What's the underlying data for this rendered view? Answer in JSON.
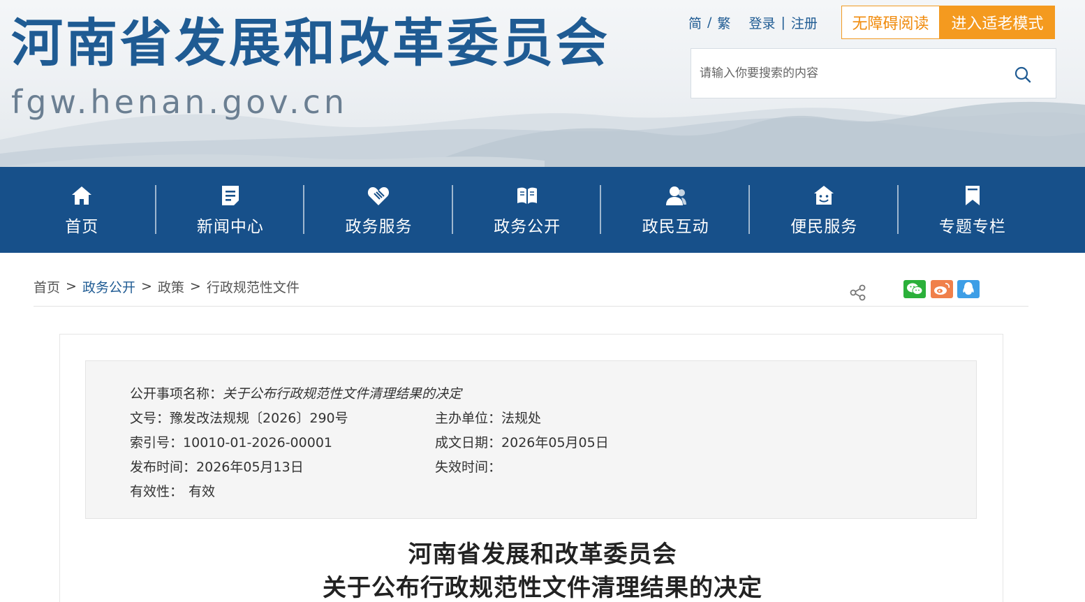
{
  "header": {
    "site_title": "河南省发展和改革委员会",
    "site_domain": "fgw.henan.gov.cn",
    "lang_simplified": "简",
    "lang_separator": "/",
    "lang_traditional": "繁",
    "login": "登录",
    "auth_separator": "|",
    "register": "注册",
    "accessibility_button": "无障碍阅读",
    "elder_mode_button": "进入适老模式",
    "search_placeholder": "请输入你要搜索的内容",
    "colors": {
      "brand_blue": "#1f5b93",
      "accent_orange": "#f49a1f"
    }
  },
  "nav": {
    "items": [
      {
        "label": "首页",
        "icon": "home-icon"
      },
      {
        "label": "新闻中心",
        "icon": "news-icon"
      },
      {
        "label": "政务服务",
        "icon": "handshake-icon"
      },
      {
        "label": "政务公开",
        "icon": "book-icon"
      },
      {
        "label": "政民互动",
        "icon": "users-icon"
      },
      {
        "label": "便民服务",
        "icon": "smiley-house-icon"
      },
      {
        "label": "专题专栏",
        "icon": "bookmark-icon"
      }
    ],
    "background": "#17508a"
  },
  "breadcrumb": {
    "items": [
      "首页",
      "政务公开",
      "政策",
      "行政规范性文件"
    ],
    "separator": ">"
  },
  "share": {
    "icons": [
      "share-icon",
      "wechat-icon",
      "weibo-icon",
      "qq-icon"
    ]
  },
  "meta": {
    "item_name_label": "公开事项名称：",
    "item_name_value": "关于公布行政规范性文件清理结果的决定",
    "doc_no_label": "文号：",
    "doc_no_value": "豫发改法规规〔2026〕290号",
    "host_unit_label": "主办单位：",
    "host_unit_value": "法规处",
    "index_no_label": "索引号：",
    "index_no_value": "10010-01-2026-00001",
    "written_date_label": "成文日期：",
    "written_date_value": "2026年05月05日",
    "publish_time_label": "发布时间：",
    "publish_time_value": "2026年05月13日",
    "expire_time_label": "失效时间：",
    "expire_time_value": "",
    "validity_label": "有效性：",
    "validity_value": "有效"
  },
  "article": {
    "title_line1": "河南省发展和改革委员会",
    "title_line2": "关于公布行政规范性文件清理结果的决定"
  }
}
